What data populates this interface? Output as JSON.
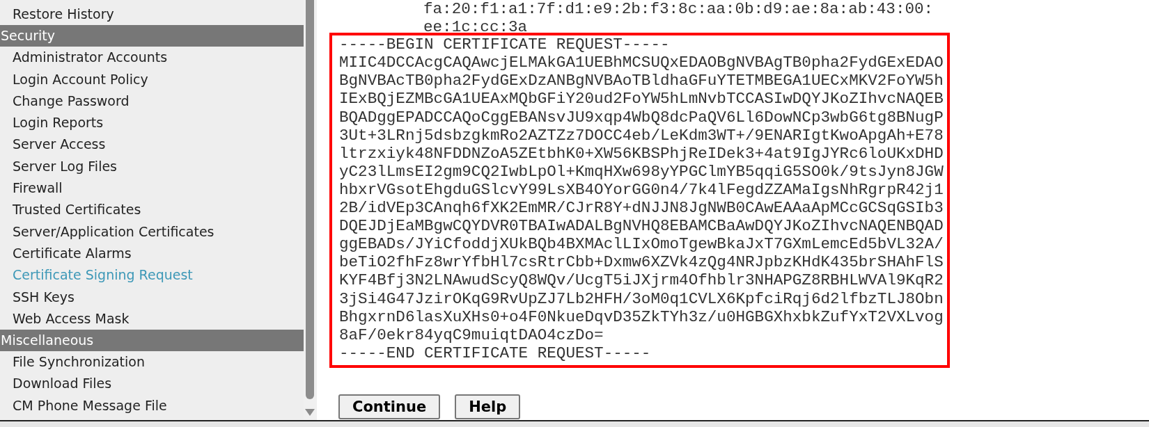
{
  "sidebar": {
    "items": [
      {
        "kind": "link",
        "label": "Restore History",
        "selected": false
      },
      {
        "kind": "header",
        "label": "Security"
      },
      {
        "kind": "link",
        "label": "Administrator Accounts",
        "selected": false
      },
      {
        "kind": "link",
        "label": "Login Account Policy",
        "selected": false
      },
      {
        "kind": "link",
        "label": "Change Password",
        "selected": false
      },
      {
        "kind": "link",
        "label": "Login Reports",
        "selected": false
      },
      {
        "kind": "link",
        "label": "Server Access",
        "selected": false
      },
      {
        "kind": "link",
        "label": "Server Log Files",
        "selected": false
      },
      {
        "kind": "link",
        "label": "Firewall",
        "selected": false
      },
      {
        "kind": "link",
        "label": "Trusted Certificates",
        "selected": false
      },
      {
        "kind": "link",
        "label": "Server/Application Certificates",
        "selected": false
      },
      {
        "kind": "link",
        "label": "Certificate Alarms",
        "selected": false
      },
      {
        "kind": "link",
        "label": "Certificate Signing Request",
        "selected": true
      },
      {
        "kind": "link",
        "label": "SSH Keys",
        "selected": false
      },
      {
        "kind": "link",
        "label": "Web Access Mask",
        "selected": false
      },
      {
        "kind": "header",
        "label": "Miscellaneous"
      },
      {
        "kind": "link",
        "label": "File Synchronization",
        "selected": false
      },
      {
        "kind": "link",
        "label": "Download Files",
        "selected": false
      },
      {
        "kind": "link",
        "label": "CM Phone Message File",
        "selected": false
      }
    ]
  },
  "fingerprint_lines": [
    "fa:20:f1:a1:7f:d1:e9:2b:f3:8c:aa:0b:d9:ae:8a:ab:43:00:",
    "ee:1c:cc:3a"
  ],
  "csr_lines": [
    "-----BEGIN CERTIFICATE REQUEST-----",
    "MIIC4DCCAcgCAQAwcjELMAkGA1UEBhMCSUQxEDAOBgNVBAgTB0pha2FydGExEDAO",
    "BgNVBAcTB0pha2FydGExDzANBgNVBAoTBldhaGFuYTETMBEGA1UECxMKV2FoYW5h",
    "IExBQjEZMBcGA1UEAxMQbGFiY20ud2FoYW5hLmNvbTCCASIwDQYJKoZIhvcNAQEB",
    "BQADggEPADCCAQoCggEBANsvJU9xqp4WbQ8dcPaQV6Ll6DowNCp3wbG6tg8BNugP",
    "3Ut+3LRnj5dsbzgkmRo2AZTZz7DOCC4eb/LeKdm3WT+/9ENARIgtKwoApgAh+E78",
    "ltrzxiyk48NFDDNZoA5ZEtbhK0+XW56KBSPhjReIDek3+4at9IgJYRc6loUKxDHD",
    "yC23lLmsEI2gm9CQ2IwbLpOl+KmqHXw698yYPGClmYB5qqiG5SO0k/9tsJyn8JGW",
    "hbxrVGsotEhgduGSlcvY99LsXB4OYorGG0n4/7k4lFegdZZAMaIgsNhRgrpR42j1",
    "2B/idVEp3CAnqh6fXK2EmMR/CJrR8Y+dNJJN8JgNWB0CAwEAAaApMCcGCSqGSIb3",
    "DQEJDjEaMBgwCQYDVR0TBAIwADALBgNVHQ8EBAMCBaAwDQYJKoZIhvcNAQENBQAD",
    "ggEBADs/JYiCfoddjXUkBQb4BXMAclLIxOmoTgewBkaJxT7GXmLemcEd5bVL32A/",
    "beTiO2fhFz8wrYfbHl7csRtrCbb+Dxmw6XZVk4zQg4NRJpbzKHdK435brSHAhFlS",
    "KYF4Bfj3N2LNAwudScyQ8WQv/UcgT5iJXjrm4Ofhblr3NHAPGZ8RBHLWVAl9KqR2",
    "3jSi4G47JzirOKqG9RvUpZJ7Lb2HFH/3oM0q1CVLX6KpfciRqj6d2lfbzTLJ8Obn",
    "BhgxrnD6lasXuXHs0+o4F0NkueDqvD35ZkTYh3z/u0HGBGXhxbkZufYxT2VXLvog",
    "8aF/0ekr84yqC9muiqtDAO4czDo=",
    "-----END CERTIFICATE REQUEST-----"
  ],
  "buttons": [
    "Continue",
    "Help"
  ]
}
